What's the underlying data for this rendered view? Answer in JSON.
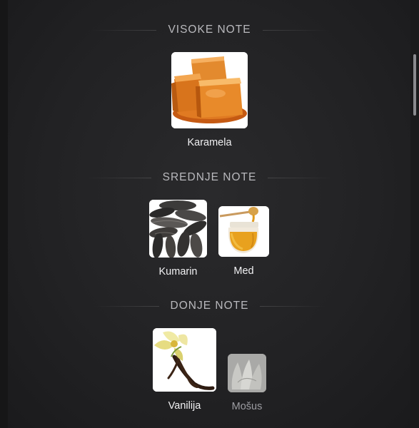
{
  "sections": {
    "top": {
      "title": "VISOKE NOTE",
      "items": [
        {
          "label": "Karamela",
          "icon": "caramel-image"
        }
      ]
    },
    "middle": {
      "title": "SREDNJE NOTE",
      "items": [
        {
          "label": "Kumarin",
          "icon": "tonka-beans-image"
        },
        {
          "label": "Med",
          "icon": "honey-jar-image"
        }
      ]
    },
    "base": {
      "title": "DONJE NOTE",
      "items": [
        {
          "label": "Vanilija",
          "icon": "vanilla-image"
        },
        {
          "label": "Mošus",
          "icon": "musk-image"
        }
      ]
    }
  },
  "colors": {
    "background": "#222224",
    "header_text": "#b9b9bd",
    "label_text": "#f1f1f3",
    "dim_label_text": "#9d9da2"
  }
}
